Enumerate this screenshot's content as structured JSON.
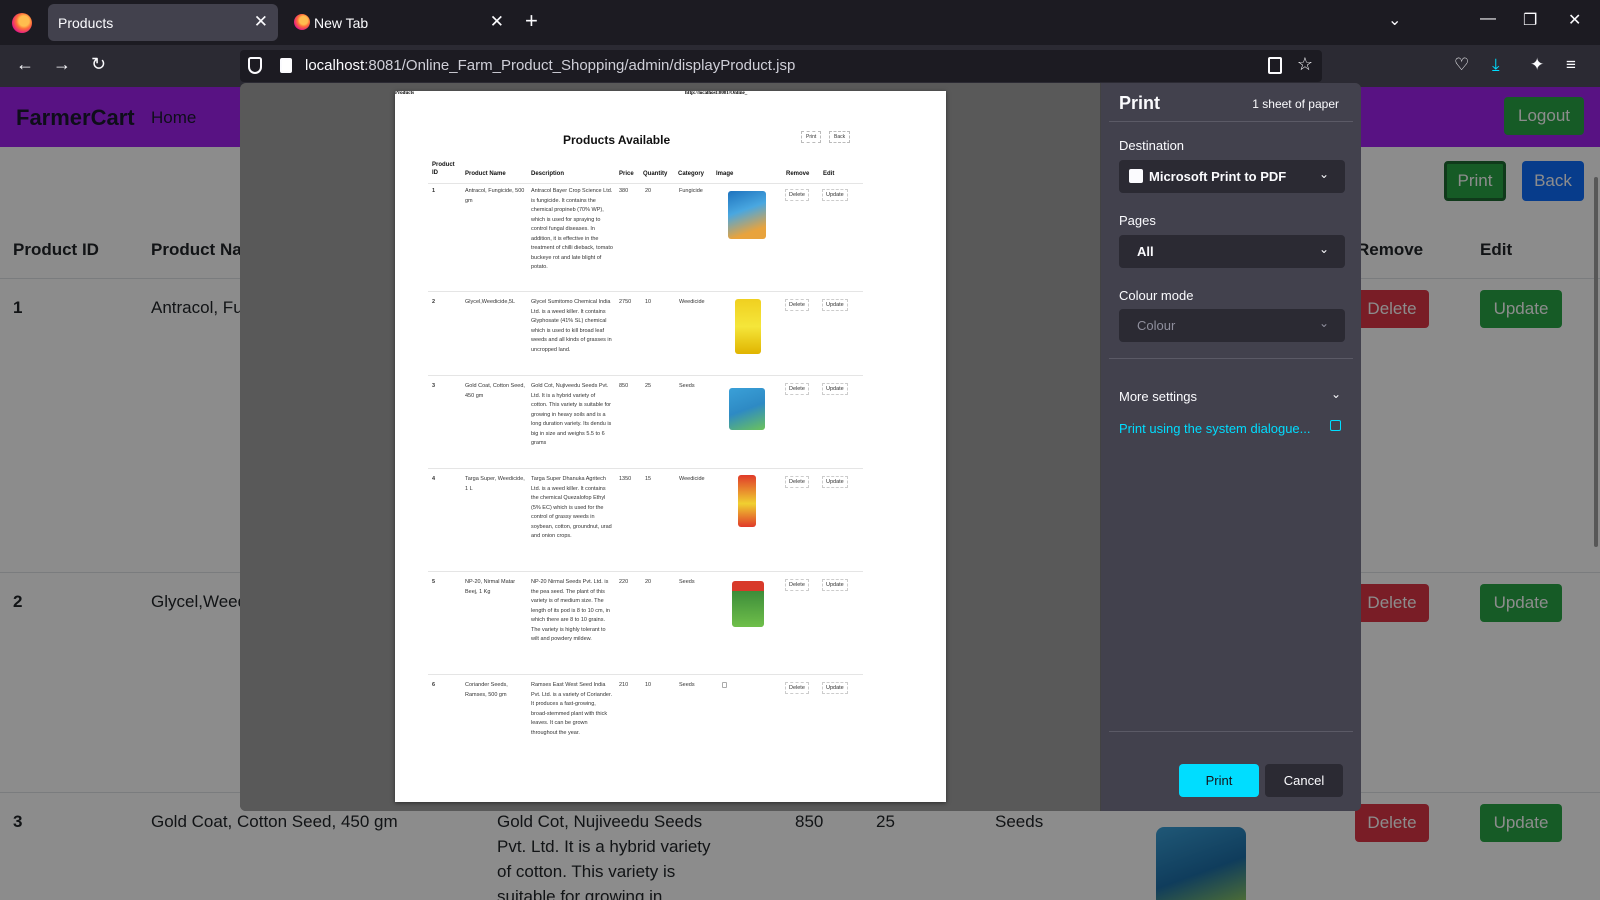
{
  "browser": {
    "tabs": [
      {
        "title": "Products",
        "active": true
      },
      {
        "title": "New Tab",
        "active": false
      }
    ],
    "url_host": "localhost",
    "url_path": ":8081/Online_Farm_Product_Shopping/admin/displayProduct.jsp"
  },
  "site": {
    "brand": "FarmerCart",
    "home": "Home",
    "logout": "Logout",
    "print": "Print",
    "back": "Back",
    "columns": {
      "product_id": "Product ID",
      "product_name_partial": "Product Na",
      "remove_partial": "Remove",
      "edit": "Edit"
    },
    "rows": [
      {
        "id": "1",
        "name_partial": "Antracol, Fu"
      },
      {
        "id": "2",
        "name_partial": "Glycel,Weed"
      },
      {
        "id": "3",
        "name": "Gold Coat, Cotton Seed, 450 gm",
        "description_partial": "Gold Cot, Nujiveedu Seeds Pvt. Ltd. It is a hybrid variety of cotton. This variety is suitable for growing in",
        "price": "850",
        "quantity": "25",
        "category": "Seeds"
      }
    ],
    "delete_label": "Delete",
    "update_label": "Update"
  },
  "print_dialog": {
    "title": "Print",
    "sheet_info": "1 sheet of paper",
    "destination_label": "Destination",
    "destination_value": "Microsoft Print to PDF",
    "pages_label": "Pages",
    "pages_value": "All",
    "colour_mode_label": "Colour mode",
    "colour_mode_value": "Colour",
    "more_settings": "More settings",
    "system_dialogue_link": "Print using the system dialogue...",
    "print_button": "Print",
    "cancel_button": "Cancel"
  },
  "preview": {
    "header_left": "Products",
    "header_center": "http://localhost:8081/Online_",
    "title": "Products Available",
    "print": "Print",
    "back": "Back",
    "columns": [
      "Product ID",
      "Product Name",
      "Description",
      "Price",
      "Quantity",
      "Category",
      "Image",
      "Remove",
      "Edit"
    ],
    "rows": [
      {
        "id": "1",
        "name": "Antracol, Fungicide, 500 gm",
        "description": "Antracol Bayer Crop Science Ltd. is fungicide. It contains the chemical propineb (70% WP), which is used for spraying to control fungal diseases. In addition, it is effective in the treatment of chilli dieback, tomato buckeye rot and late blight of potato.",
        "price": "380",
        "quantity": "20",
        "category": "Fungicide"
      },
      {
        "id": "2",
        "name": "Glycel,Weedicide,5L",
        "description": "Glycel Sumitomo Chemical India Ltd. is a weed killer. It contains Glyphosate (41% SL) chemical which is used to kill broad leaf weeds and all kinds of grasses in uncropped land.",
        "price": "2750",
        "quantity": "10",
        "category": "Weedicide"
      },
      {
        "id": "3",
        "name": "Gold Coat, Cotton Seed, 450 gm",
        "description": "Gold Cot, Nujiveedu Seeds Pvt. Ltd. It is a hybrid variety of cotton. This variety is suitable for growing in heavy soils and is a long duration variety. Its dendu is big in size and weighs 5.5 to 6 grams",
        "price": "850",
        "quantity": "25",
        "category": "Seeds"
      },
      {
        "id": "4",
        "name": "Targa Super, Weedicide, 1 L",
        "description": "Targa Super Dhanuka Agritech Ltd. is a weed killer. It contains the chemical Quezalofop Ethyl (5% EC) which is used for the control of grassy weeds in soybean, cotton, groundnut, urad and onion crops.",
        "price": "1350",
        "quantity": "15",
        "category": "Weedicide"
      },
      {
        "id": "5",
        "name": "NP-20, Nirmal Matar Beej, 1 Kg",
        "description": "NP-20 Nirmal Seeds Pvt. Ltd. is the pea seed. The plant of this variety is of medium size. The length of its pod is 8 to 10 cm, in which there are 8 to 10 grains. The variety is highly tolerant to wilt and powdery mildew.",
        "price": "220",
        "quantity": "20",
        "category": "Seeds"
      },
      {
        "id": "6",
        "name": "Coriander Seeds, Ramses, 500 gm",
        "description": "Ramses East West Seed India Pvt. Ltd. is a variety of Coriander. It produces a fast-growing, broad-stemmed plant with thick leaves. It can be grown throughout the year.",
        "price": "210",
        "quantity": "10",
        "category": "Seeds"
      }
    ],
    "delete": "Delete",
    "update": "Update"
  },
  "colors": {
    "header_purple": "#a021ef",
    "success_green": "#28a745",
    "danger_red": "#dc3545",
    "primary_blue": "#0d6efd",
    "dialog_accent": "#00ddff"
  }
}
